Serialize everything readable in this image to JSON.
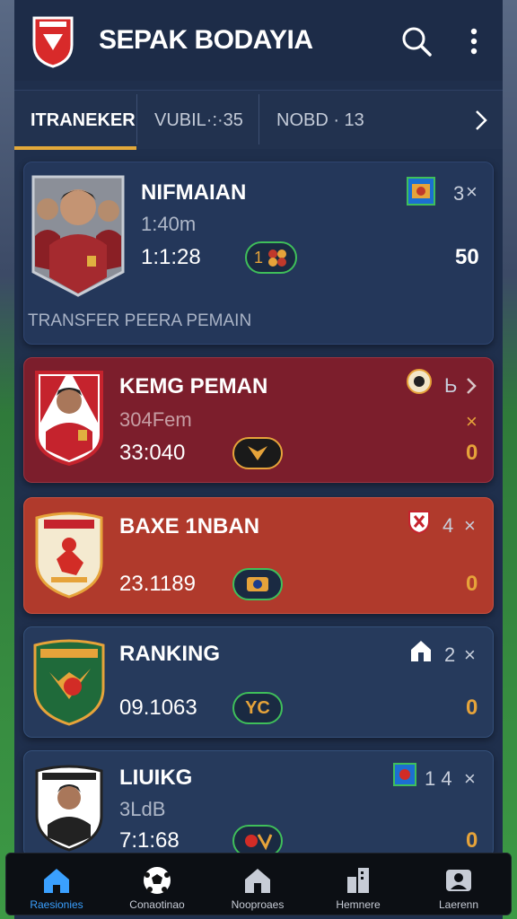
{
  "header": {
    "title": "SEPAK BODAYIA"
  },
  "tabs": [
    {
      "label": "ITRANEKER"
    },
    {
      "label": "VUBIL·:·35"
    },
    {
      "label": "NOBD · 13"
    }
  ],
  "cards": [
    {
      "name": "NIFMAIAN",
      "sub": "1:40m",
      "time": "1:1:28",
      "count": "3",
      "close": "×",
      "score": "50",
      "pill_text": "1",
      "footer": "TRANSFER PEERA PEMAIN"
    },
    {
      "name": "KEMG PEMAN",
      "sub": "304Fem",
      "time": "33:040",
      "count": "Ь",
      "close": "×",
      "score": "0"
    },
    {
      "name": "BAXE 1NBAN",
      "time": "23.1189",
      "count": "4",
      "close": "×",
      "score": "0"
    },
    {
      "name": "RANKING",
      "time": "09.1063",
      "count": "2",
      "close": "×",
      "score": "0",
      "pill_text": "YC"
    },
    {
      "name": "LIUIKG",
      "sub": "3LdB",
      "time": "7:1:68",
      "count": "1 4",
      "close": "×",
      "score": "0"
    }
  ],
  "bottom_nav": [
    {
      "label": "Raesionies",
      "icon": "home-icon"
    },
    {
      "label": "Conaotinao",
      "icon": "soccer-ball-icon"
    },
    {
      "label": "Nooproaes",
      "icon": "house-icon"
    },
    {
      "label": "Hemnere",
      "icon": "building-icon"
    },
    {
      "label": "Laerenn",
      "icon": "profile-icon"
    }
  ],
  "colors": {
    "accent": "#e3a93a",
    "score": "#e6a33a",
    "nav_active": "#3aa0ff",
    "pill_border": "#3fbf5a"
  }
}
